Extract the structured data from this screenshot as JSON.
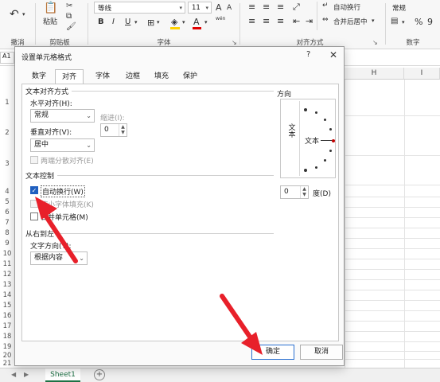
{
  "ribbon": {
    "clipboard": {
      "group_label": "剪贴板",
      "paste_label": "粘贴"
    },
    "undo": {
      "group_label": "撤消"
    },
    "font": {
      "group_label": "字体",
      "font_name": "等线",
      "font_size": "11",
      "bold": "B",
      "italic": "I",
      "underline": "U",
      "increase_size": "A",
      "decrease_size": "A",
      "fill_color": "#ffd200",
      "font_color": "#e00000",
      "wen_label": "wén"
    },
    "alignment": {
      "group_label": "对齐方式",
      "wrap_text_label": "自动换行",
      "merge_center_label": "合并后居中"
    },
    "number": {
      "group_label": "数字",
      "format": "常规",
      "percent": "%",
      "comma": "9"
    }
  },
  "grid": {
    "namebox": "A1",
    "columns": [
      "H",
      "I"
    ],
    "rows": [
      "1",
      "2",
      "3",
      "4",
      "5",
      "6",
      "7",
      "8",
      "9",
      "10",
      "11",
      "12",
      "13",
      "14",
      "15",
      "16",
      "17",
      "18",
      "19",
      "20",
      "21"
    ]
  },
  "sheets": {
    "active_tab": "Sheet1"
  },
  "dialog": {
    "title": "设置单元格格式",
    "help": "?",
    "close": "✕",
    "tabs": [
      "数字",
      "对齐",
      "字体",
      "边框",
      "填充",
      "保护"
    ],
    "active_tab_index": 1,
    "text_alignment": {
      "section_label": "文本对齐方式",
      "horizontal_label": "水平对齐(H):",
      "horizontal_value": "常规",
      "vertical_label": "垂直对齐(V):",
      "vertical_value": "居中",
      "indent_label": "缩进(I):",
      "indent_value": "0",
      "justify_distributed_label": "两端分散对齐(E)"
    },
    "text_control": {
      "section_label": "文本控制",
      "wrap_text_label": "自动换行(W)",
      "wrap_text_checked": true,
      "shrink_to_fit_label": "缩小字体填充(K)",
      "merge_cells_label": "合并单元格(M)"
    },
    "rtl": {
      "section_label": "从右到左",
      "direction_label": "文字方向(T):",
      "direction_value": "根据内容"
    },
    "orientation": {
      "section_label": "方向",
      "vertical_text": "文本",
      "horizontal_text": "文本",
      "degrees_value": "0",
      "degrees_label": "度(D)"
    },
    "ok_label": "确定",
    "cancel_label": "取消"
  },
  "annotation": {
    "arrow_color": "#e8202a"
  }
}
